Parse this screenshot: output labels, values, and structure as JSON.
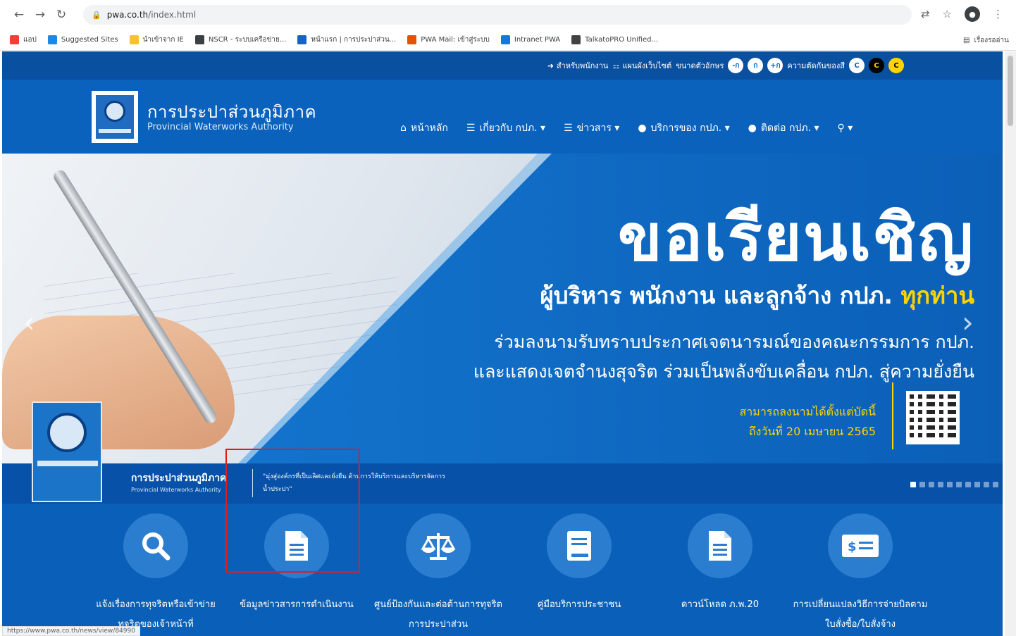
{
  "browser": {
    "url_domain": "pwa.co.th",
    "url_path": "/index.html",
    "bookmarks": [
      {
        "label": "แอป",
        "color": "#ea4335"
      },
      {
        "label": "Suggested Sites",
        "color": "#1e88e5"
      },
      {
        "label": "นำเข้าจาก IE",
        "color": "#fbc02d"
      },
      {
        "label": "NSCR - ระบบเครือข่าย...",
        "color": "#3c4043"
      },
      {
        "label": "หน้าแรก | การประปาส่วน...",
        "color": "#1565c0"
      },
      {
        "label": "PWA Mail: เข้าสู่ระบบ",
        "color": "#e65100"
      },
      {
        "label": "Intranet PWA",
        "color": "#1976d2"
      },
      {
        "label": "TalkatoPRO Unified...",
        "color": "#424242"
      }
    ],
    "reading_list": "เรื่องรออ่าน",
    "status_url": "https://www.pwa.co.th/news/view/84990"
  },
  "access": {
    "staff": "สำหรับพนักงาน",
    "sitemap": "แผนผังเว็บไซต์",
    "font_size": "ขนาดตัวอักษร",
    "font_btns": [
      "-ก",
      "ก",
      "+ก"
    ],
    "contrast": "ความตัดกันของสี",
    "contrast_btns": [
      "C",
      "C",
      "C"
    ]
  },
  "header": {
    "org_th": "การประปาส่วนภูมิภาค",
    "org_en": "Provincial Waterworks Authority",
    "nav": [
      {
        "icon": "home-icon",
        "glyph": "⌂",
        "label": "หน้าหลัก"
      },
      {
        "icon": "list-icon",
        "glyph": "☰",
        "label": "เกี่ยวกับ กปภ. ▾"
      },
      {
        "icon": "list-icon",
        "glyph": "☰",
        "label": "ข่าวสาร ▾"
      },
      {
        "icon": "drop-icon",
        "glyph": "●",
        "label": "บริการของ กปภ. ▾"
      },
      {
        "icon": "drop-icon",
        "glyph": "●",
        "label": "ติดต่อ กปภ. ▾"
      }
    ],
    "search_glyph": "⚲ ▾"
  },
  "banner": {
    "title": "ขอเรียนเชิญ",
    "subtitle_pre": "ผู้บริหาร พนักงาน และลูกจ้าง กปภ.",
    "subtitle_hl": "ทุกท่าน",
    "line1": "ร่วมลงนามรับทราบประกาศเจตนารมณ์ของคณะกรรมการ กปภ.",
    "line2": "และแสดงเจตจำนงสุจริต ร่วมเป็นพลังขับเคลื่อน กปภ. สู่ความยั่งยืน",
    "sign_line1": "สามารถลงนามได้ตั้งแต่บัดนี้",
    "sign_line2": "ถึงวันที่ 20 เมษายน 2565",
    "footer_name": "การประปาส่วนภูมิภาค",
    "footer_name_en": "Provincial Waterworks Authority",
    "footer_quote": "\"มุ่งสู่องค์กรที่เป็นเลิศและยั่งยืน ด้านการให้บริการและบริหารจัดการน้ำประปา\"",
    "arrow_left": "‹",
    "arrow_right": "›"
  },
  "services": [
    {
      "icon": "search-icon",
      "label": "แจ้งเรื่องการทุจริตหรือเข้าข่ายทุจริตของเจ้าหน้าที่"
    },
    {
      "icon": "document-icon",
      "label": "ข้อมูลข่าวสารการดำเนินงาน"
    },
    {
      "icon": "scale-icon",
      "label": "ศูนย์ป้องกันและต่อต้านการทุจริต การประปาส่วน"
    },
    {
      "icon": "book-icon",
      "label": "คู่มือบริการประชาชน"
    },
    {
      "icon": "document-icon",
      "label": "ดาวน์โหลด ภ.พ.20"
    },
    {
      "icon": "bill-icon",
      "label": "การเปลี่ยนแปลงวิธีการจ่ายบิลตามใบสั่งซื้อ/ใบสั่งจ้าง"
    }
  ]
}
